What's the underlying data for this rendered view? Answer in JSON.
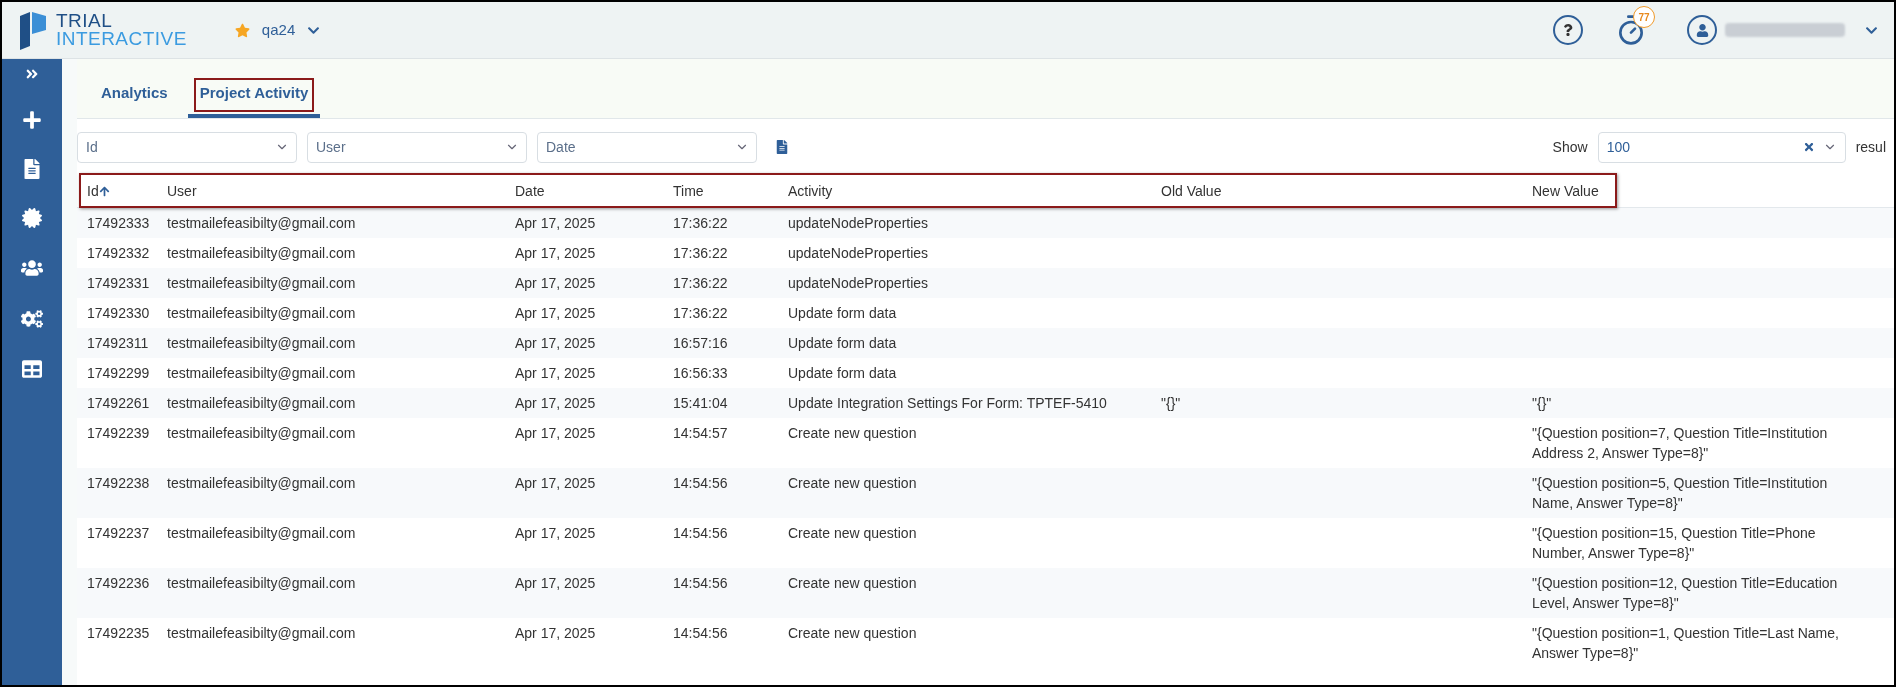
{
  "header": {
    "logo": {
      "line_1": "TRIAL",
      "line_2": "INTERACTIVE"
    },
    "project": {
      "name": "qa24",
      "favorite": true
    },
    "timer_badge": "77"
  },
  "tabs": [
    {
      "label": "Analytics",
      "selected": false,
      "annotated": false
    },
    {
      "label": "Project Activity",
      "selected": true,
      "annotated": true
    }
  ],
  "filters": [
    {
      "placeholder": "Id"
    },
    {
      "placeholder": "User"
    },
    {
      "placeholder": "Date"
    }
  ],
  "page_size": {
    "label": "Show",
    "value": "100",
    "suffix": "resul"
  },
  "table": {
    "header_annotated": true,
    "columns": [
      {
        "label": "Id",
        "sorted": true
      },
      {
        "label": "User",
        "sorted": false
      },
      {
        "label": "Date",
        "sorted": false
      },
      {
        "label": "Time",
        "sorted": false
      },
      {
        "label": "Activity",
        "sorted": false
      },
      {
        "label": "Old Value",
        "sorted": false
      },
      {
        "label": "New Value",
        "sorted": false
      }
    ],
    "rows": [
      [
        "17492333",
        "testmailefeasibilty@gmail.com",
        "Apr 17, 2025",
        "17:36:22",
        "updateNodeProperties",
        "",
        ""
      ],
      [
        "17492332",
        "testmailefeasibilty@gmail.com",
        "Apr 17, 2025",
        "17:36:22",
        "updateNodeProperties",
        "",
        ""
      ],
      [
        "17492331",
        "testmailefeasibilty@gmail.com",
        "Apr 17, 2025",
        "17:36:22",
        "updateNodeProperties",
        "",
        ""
      ],
      [
        "17492330",
        "testmailefeasibilty@gmail.com",
        "Apr 17, 2025",
        "17:36:22",
        "Update form data",
        "",
        ""
      ],
      [
        "17492311",
        "testmailefeasibilty@gmail.com",
        "Apr 17, 2025",
        "16:57:16",
        "Update form data",
        "",
        ""
      ],
      [
        "17492299",
        "testmailefeasibilty@gmail.com",
        "Apr 17, 2025",
        "16:56:33",
        "Update form data",
        "",
        ""
      ],
      [
        "17492261",
        "testmailefeasibilty@gmail.com",
        "Apr 17, 2025",
        "15:41:04",
        "Update Integration Settings For Form: TPTEF-5410",
        "\"{}\"",
        "\"{}\""
      ],
      [
        "17492239",
        "testmailefeasibilty@gmail.com",
        "Apr 17, 2025",
        "14:54:57",
        "Create new question",
        "",
        "\"{Question position=7, Question Title=Institution Address 2, Answer Type=8}\""
      ],
      [
        "17492238",
        "testmailefeasibilty@gmail.com",
        "Apr 17, 2025",
        "14:54:56",
        "Create new question",
        "",
        "\"{Question position=5, Question Title=Institution Name, Answer Type=8}\""
      ],
      [
        "17492237",
        "testmailefeasibilty@gmail.com",
        "Apr 17, 2025",
        "14:54:56",
        "Create new question",
        "",
        "\"{Question position=15, Question Title=Phone Number, Answer Type=8}\""
      ],
      [
        "17492236",
        "testmailefeasibilty@gmail.com",
        "Apr 17, 2025",
        "14:54:56",
        "Create new question",
        "",
        "\"{Question position=12, Question Title=Education Level, Answer Type=8}\""
      ],
      [
        "17492235",
        "testmailefeasibilty@gmail.com",
        "Apr 17, 2025",
        "14:54:56",
        "Create new question",
        "",
        "\"{Question position=1, Question Title=Last Name, Answer Type=8}\""
      ]
    ]
  }
}
